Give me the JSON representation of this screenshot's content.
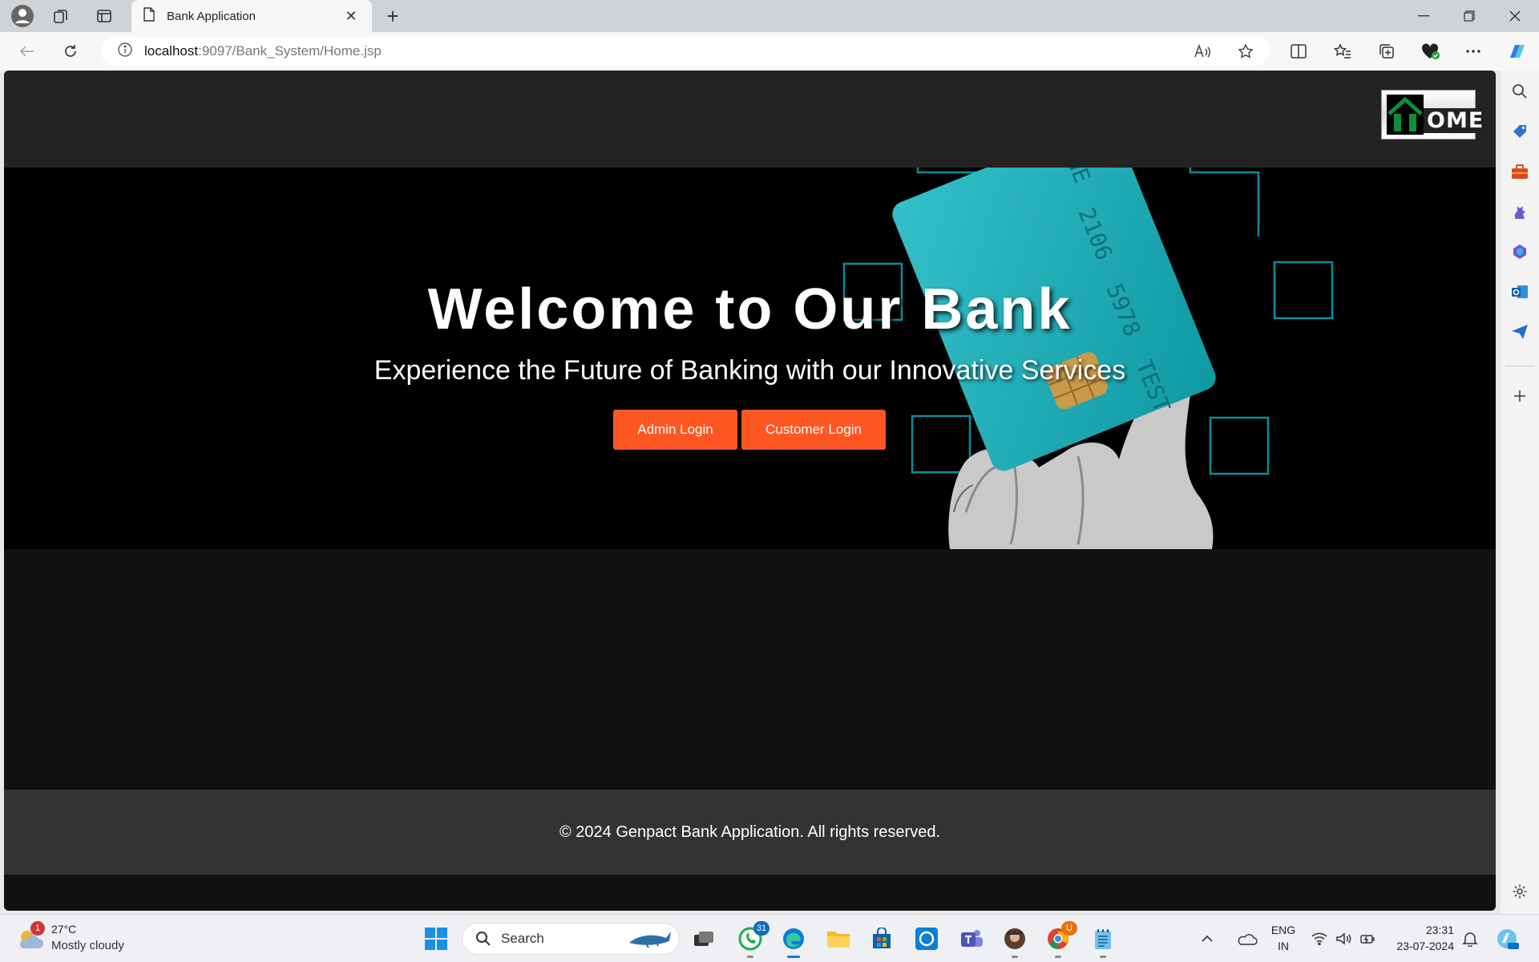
{
  "browser": {
    "tab_title": "Bank Application",
    "url_host": "localhost",
    "url_path": ":9097/Bank_System/Home.jsp"
  },
  "page": {
    "logo_text": "OME",
    "hero_title": "Welcome to Our Bank",
    "hero_subtitle": "Experience the Future of Banking with our Innovative Services",
    "admin_login_label": "Admin Login",
    "customer_login_label": "Customer Login",
    "footer_text": "© 2024 Genpact Bank Application. All rights reserved.",
    "card_texts": [
      "2106",
      "5978",
      "TEST",
      "NE"
    ]
  },
  "taskbar": {
    "weather_badge": "1",
    "weather_temp": "27°C",
    "weather_condition": "Mostly cloudy",
    "search_label": "Search",
    "whatsapp_badge": "31",
    "chrome_badge": "U",
    "lang_1": "ENG",
    "lang_2": "IN",
    "time": "23:31",
    "date": "23-07-2024"
  },
  "colors": {
    "accent_button": "#ff5722",
    "header_bg": "#232323",
    "footer_bg": "#333333",
    "hero_bg": "#000000",
    "card_teal": "#12b4c0"
  }
}
